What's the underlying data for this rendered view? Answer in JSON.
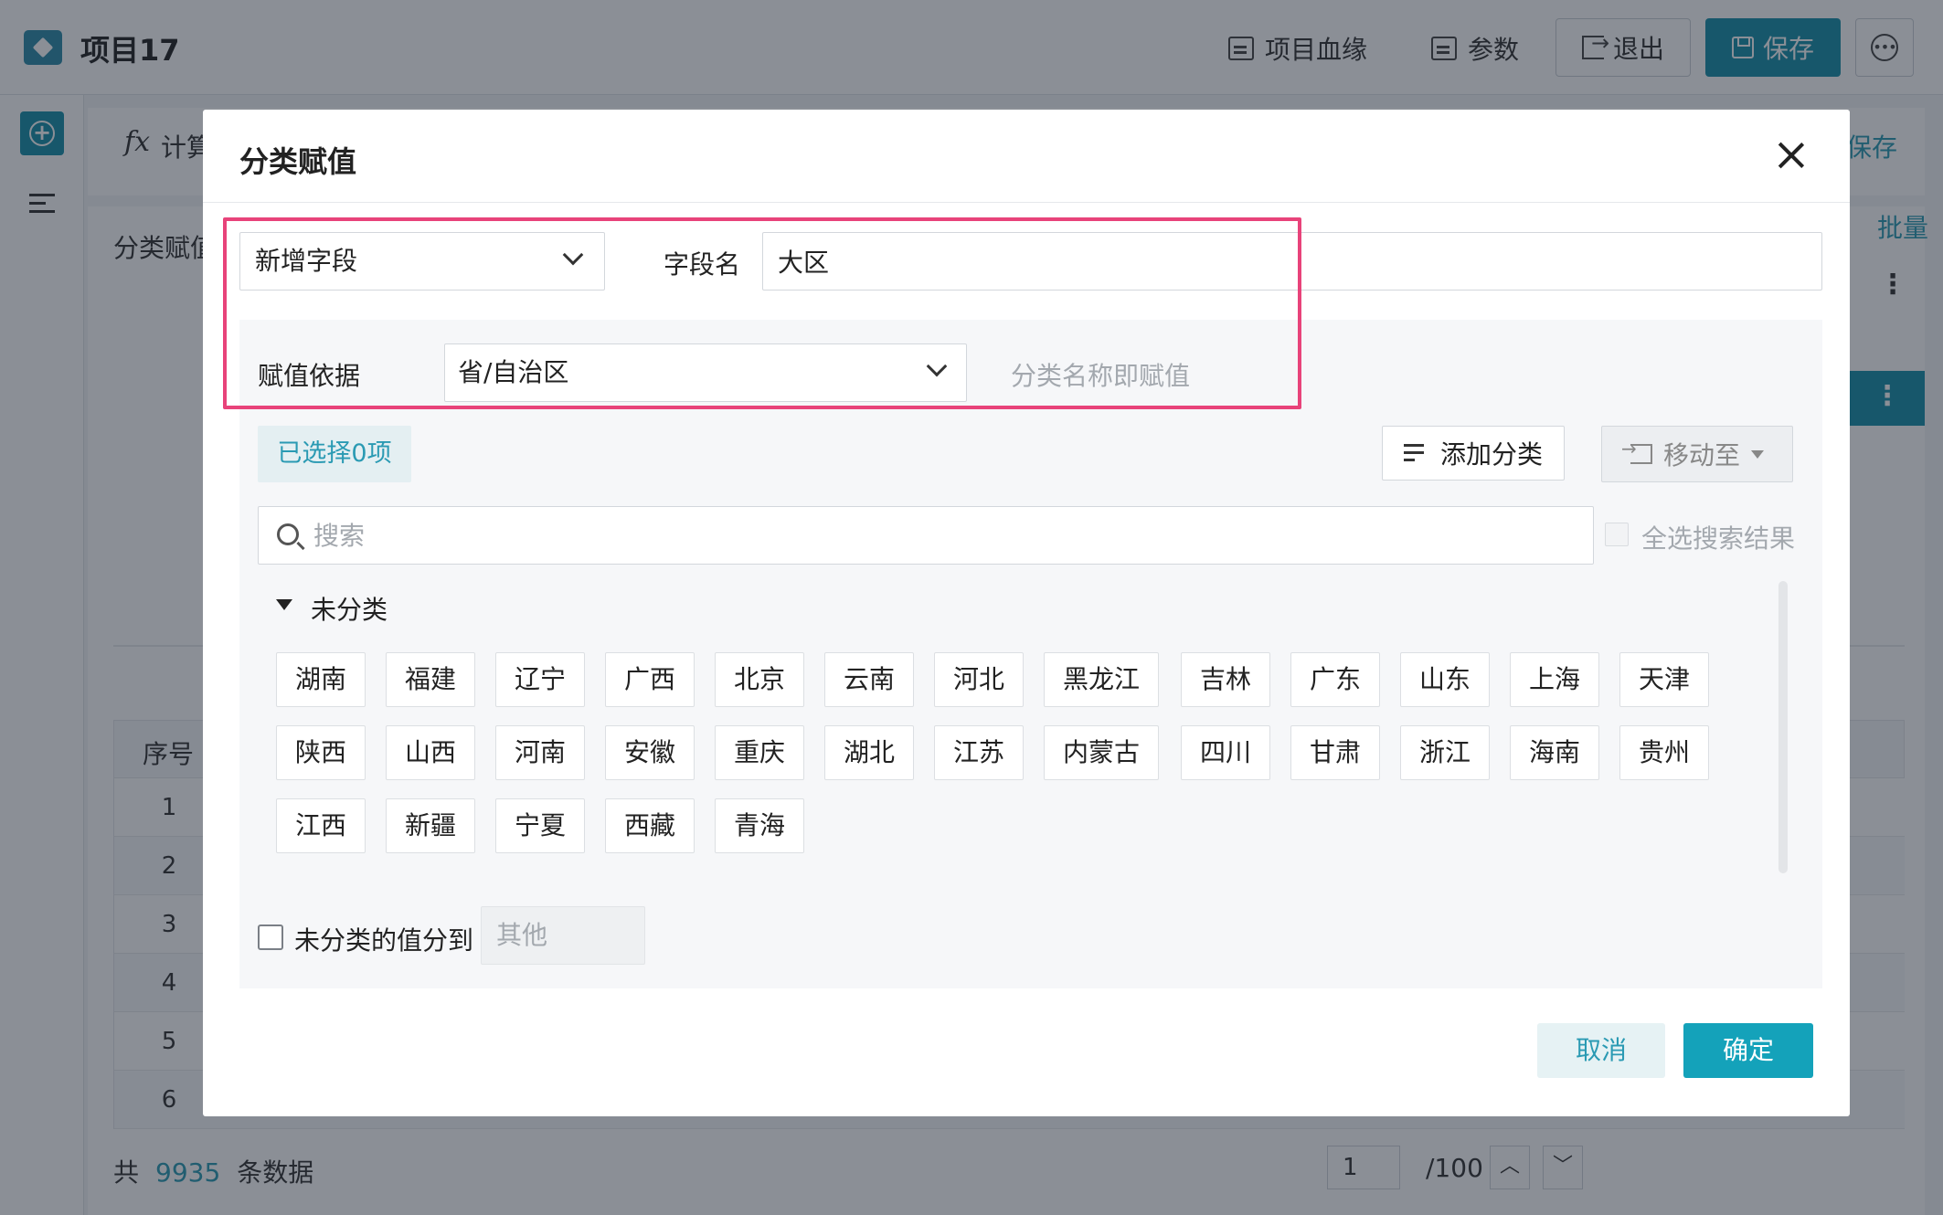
{
  "app": {
    "project_title": "项目17",
    "toolbar": {
      "lineage_label": "项目血缘",
      "params_label": "参数",
      "exit_label": "退出",
      "save_label": "保存"
    }
  },
  "background": {
    "calc_label": "计算",
    "panel_save": "保存",
    "batch_label": "批量",
    "category_label": "分类赋值",
    "table_header": "序号",
    "row_numbers": [
      "1",
      "2",
      "3",
      "4",
      "5",
      "6"
    ],
    "footer": {
      "prefix": "共",
      "count": "9935",
      "suffix": "条数据"
    },
    "pager": {
      "current": "1",
      "total": "/100"
    }
  },
  "dialog": {
    "title": "分类赋值",
    "field_type_select": "新增字段",
    "field_name_label": "字段名",
    "field_name_value": "大区",
    "basis_label": "赋值依据",
    "basis_select": "省/自治区",
    "basis_hint": "分类名称即赋值",
    "selected_count": "已选择0项",
    "add_category": "添加分类",
    "move_to": "移动至",
    "search_placeholder": "搜索",
    "select_all_results": "全选搜索结果",
    "group_name": "未分类",
    "tags": [
      "湖南",
      "福建",
      "辽宁",
      "广西",
      "北京",
      "云南",
      "河北",
      "黑龙江",
      "吉林",
      "广东",
      "山东",
      "上海",
      "天津",
      "陕西",
      "山西",
      "河南",
      "安徽",
      "重庆",
      "湖北",
      "江苏",
      "内蒙古",
      "四川",
      "甘肃",
      "浙江",
      "海南",
      "贵州",
      "江西",
      "新疆",
      "宁夏",
      "西藏",
      "青海"
    ],
    "unassigned_label": "未分类的值分到",
    "unassigned_value": "其他",
    "cancel_label": "取消",
    "confirm_label": "确定"
  },
  "colors": {
    "accent": "#14a2ba",
    "highlight": "#e8437a"
  }
}
